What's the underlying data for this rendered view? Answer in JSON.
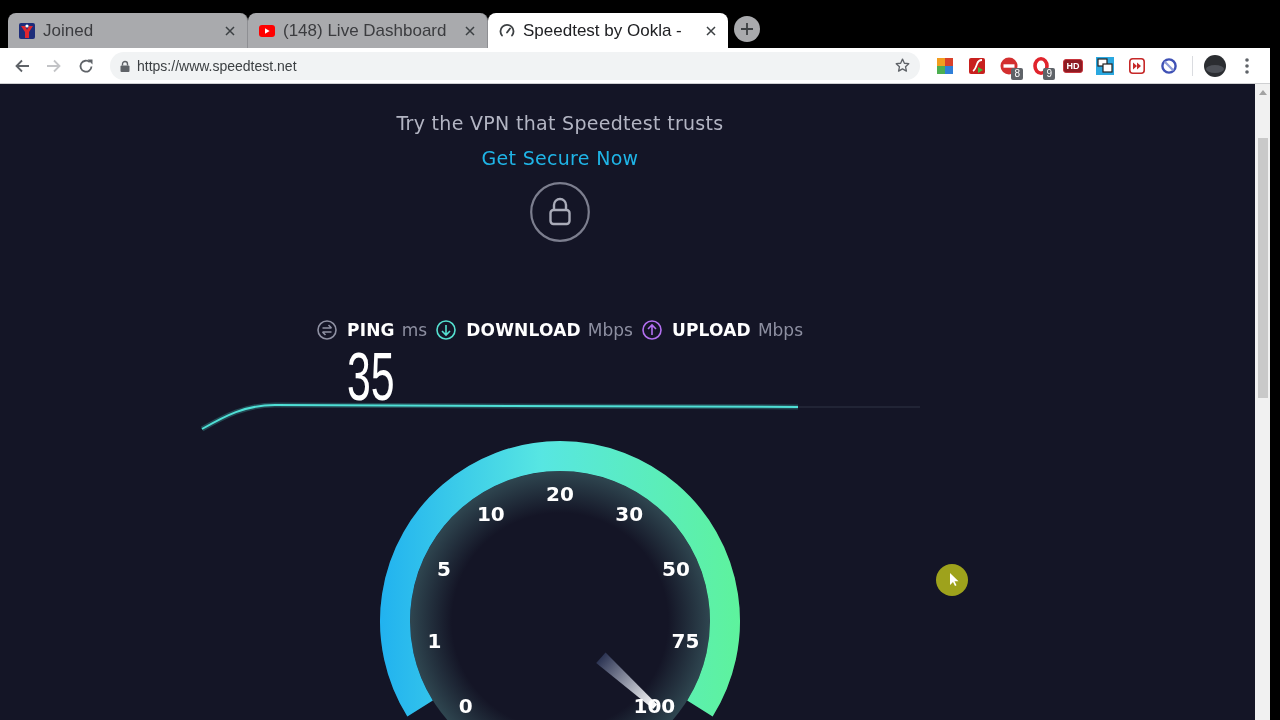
{
  "browser": {
    "tabs": [
      {
        "title": "Joined",
        "selected": false
      },
      {
        "title": "(148) Live Dashboard",
        "selected": false
      },
      {
        "title": "Speedtest by Ookla -",
        "selected": true
      }
    ],
    "toolbar": {
      "nav_buttons": [
        {
          "kind": "back",
          "disabled": false
        },
        {
          "kind": "forward",
          "disabled": true
        },
        {
          "kind": "reload",
          "disabled": false
        }
      ],
      "url": "https://www.speedtest.net",
      "extensions": [
        {
          "kind": "tiles"
        },
        {
          "kind": "flash"
        },
        {
          "kind": "stop",
          "badge": "8"
        },
        {
          "kind": "ring",
          "badge": "9"
        },
        {
          "kind": "hd",
          "label": "HD"
        },
        {
          "kind": "windows"
        },
        {
          "kind": "skip"
        },
        {
          "kind": "slash"
        }
      ]
    }
  },
  "page": {
    "promo": {
      "text": "Try the VPN that Speedtest trusts",
      "link": "Get Secure Now"
    },
    "metrics": [
      {
        "kind": "ping",
        "label": "PING",
        "unit": "ms",
        "value": "35"
      },
      {
        "kind": "download",
        "label": "DOWNLOAD",
        "unit": "Mbps"
      },
      {
        "kind": "upload",
        "label": "UPLOAD",
        "unit": "Mbps"
      }
    ],
    "gauge": {
      "scale": [
        "0",
        "1",
        "5",
        "10",
        "20",
        "30",
        "50",
        "75",
        "100"
      ],
      "level": 1
    }
  }
}
